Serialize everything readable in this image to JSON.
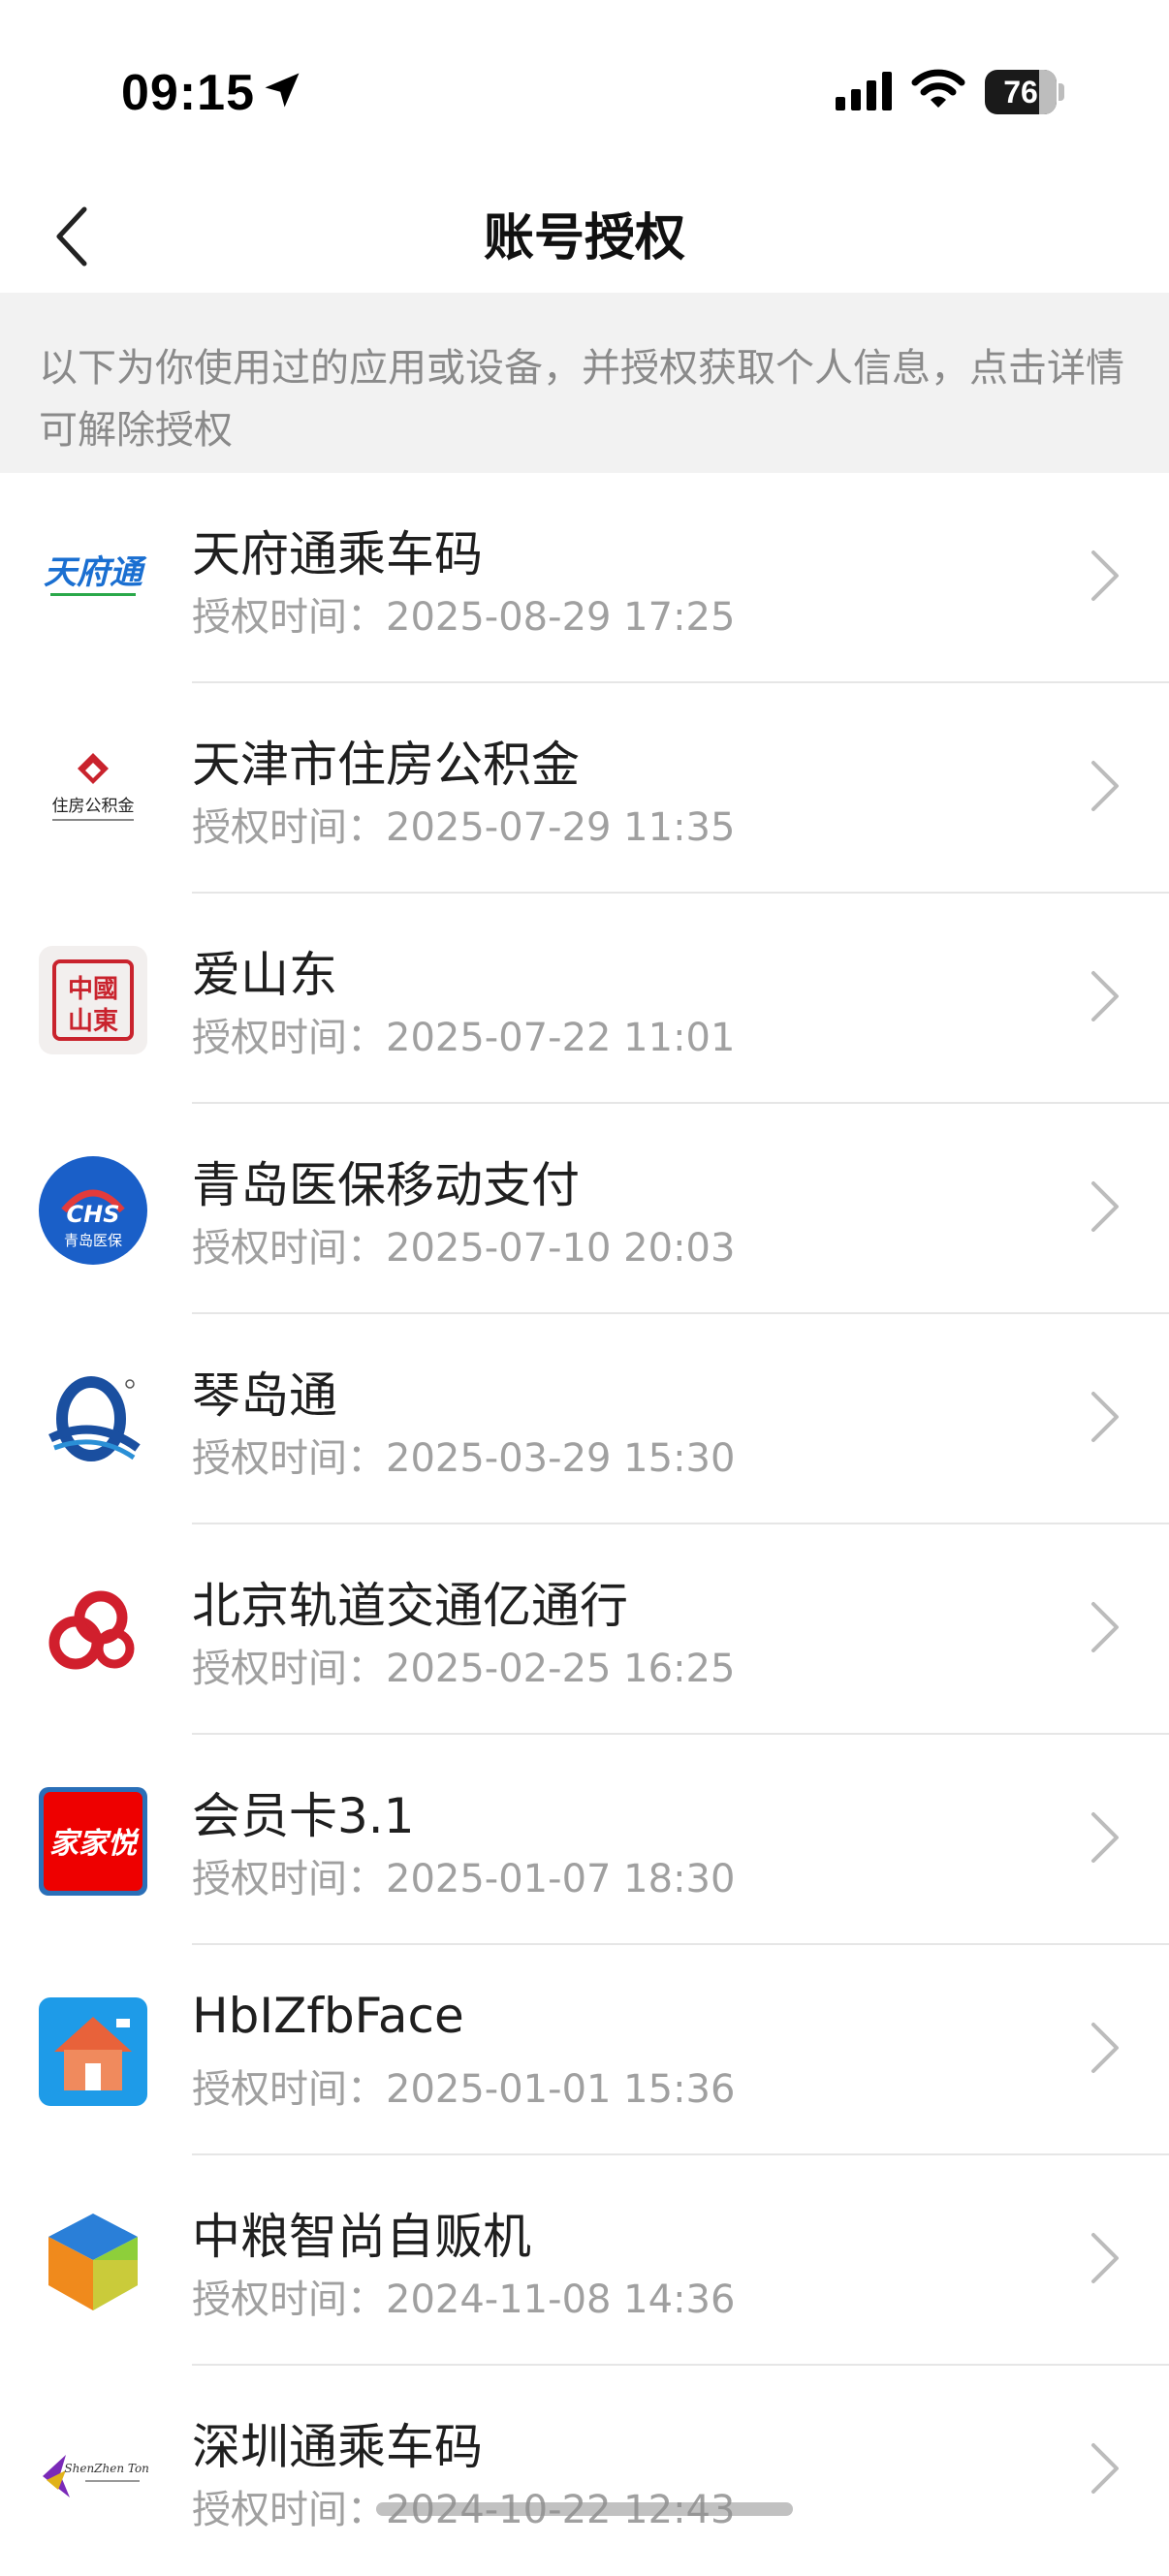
{
  "status_bar": {
    "time": "09:15",
    "battery": "76",
    "battery_level": 76
  },
  "nav": {
    "title": "账号授权"
  },
  "notice": {
    "text": "以下为你使用过的应用或设备，并授权获取个人信息，点击详情可解除授权"
  },
  "items": [
    {
      "name": "天府通乘车码",
      "label": "授权时间：",
      "time": "2025-08-29 17:25",
      "logo": "tianfutong-logo",
      "logo_text": "天府通"
    },
    {
      "name": "天津市住房公积金",
      "label": "授权时间：",
      "time": "2025-07-29 11:35",
      "logo": "tianjin-housing-fund-logo",
      "logo_text": "住房公积金"
    },
    {
      "name": "爱山东",
      "label": "授权时间：",
      "time": "2025-07-22 11:01",
      "logo": "aishandong-seal-logo",
      "logo_text": "中國山東"
    },
    {
      "name": "青岛医保移动支付",
      "label": "授权时间：",
      "time": "2025-07-10 20:03",
      "logo": "qingdao-medical-insurance-logo",
      "logo_text": "青岛医保"
    },
    {
      "name": "琴岛通",
      "label": "授权时间：",
      "time": "2025-03-29 15:30",
      "logo": "qindaotong-logo"
    },
    {
      "name": "北京轨道交通亿通行",
      "label": "授权时间：",
      "time": "2025-02-25 16:25",
      "logo": "yitongxing-knot-logo"
    },
    {
      "name": "会员卡3.1",
      "label": "授权时间：",
      "time": "2025-01-07 18:30",
      "logo": "jiajiayue-logo",
      "logo_text": "家家悦"
    },
    {
      "name": "HbIZfbFace",
      "label": "授权时间：",
      "time": "2025-01-01 15:36",
      "logo": "house-logo"
    },
    {
      "name": "中粮智尚自贩机",
      "label": "授权时间：",
      "time": "2024-11-08 14:36",
      "logo": "cube-logo"
    },
    {
      "name": "深圳通乘车码",
      "label": "授权时间：",
      "time": "2024-10-22 12:43",
      "logo": "shenzhentong-logo",
      "logo_text": "ShenZhen Tong"
    }
  ],
  "colors": {
    "accent_blue": "#1a6fd1",
    "seal_red": "#c9232d",
    "muted_text": "#a0a0a0",
    "notice_bg": "#f2f2f2"
  }
}
